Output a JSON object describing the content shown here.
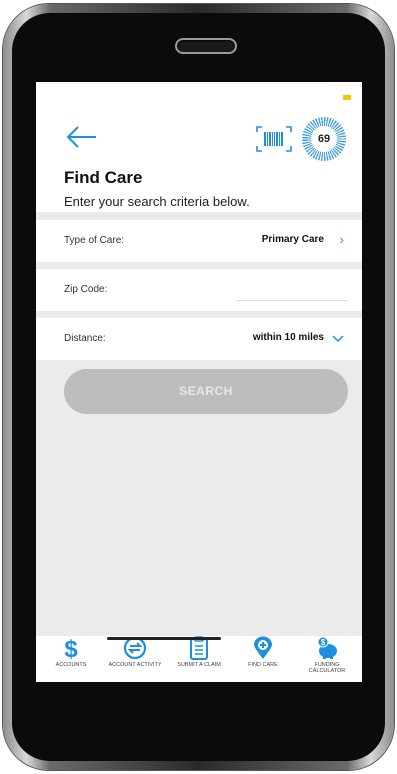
{
  "status": {
    "indicator_color": "#f6c700"
  },
  "header": {
    "back_icon": "back-arrow-icon",
    "barcode_icon": "barcode-icon",
    "badge_value": "69",
    "title": "Find Care",
    "subtitle": "Enter your search criteria below."
  },
  "form": {
    "type_of_care": {
      "label": "Type of Care:",
      "value": "Primary Care",
      "icon": "chevron-right-icon"
    },
    "zip_code": {
      "label": "Zip Code:",
      "value": ""
    },
    "distance": {
      "label": "Distance:",
      "value": "within 10 miles",
      "icon": "chevron-down-icon"
    }
  },
  "search_button": {
    "label": "SEARCH",
    "state": "disabled"
  },
  "tabbar": {
    "items": [
      {
        "label": "ACCOUNTS",
        "icon": "dollar-icon"
      },
      {
        "label": "ACCOUNT ACTIVITY",
        "icon": "exchange-icon"
      },
      {
        "label": "SUBMIT A CLAIM",
        "icon": "clipboard-icon"
      },
      {
        "label": "FIND CARE",
        "icon": "location-plus-icon"
      },
      {
        "label": "FUNDING CALCULATOR",
        "icon": "piggy-bank-icon"
      }
    ]
  },
  "colors": {
    "accent": "#1e8fe0",
    "button_disabled": "#bdbdbd",
    "background": "#ebebeb"
  }
}
